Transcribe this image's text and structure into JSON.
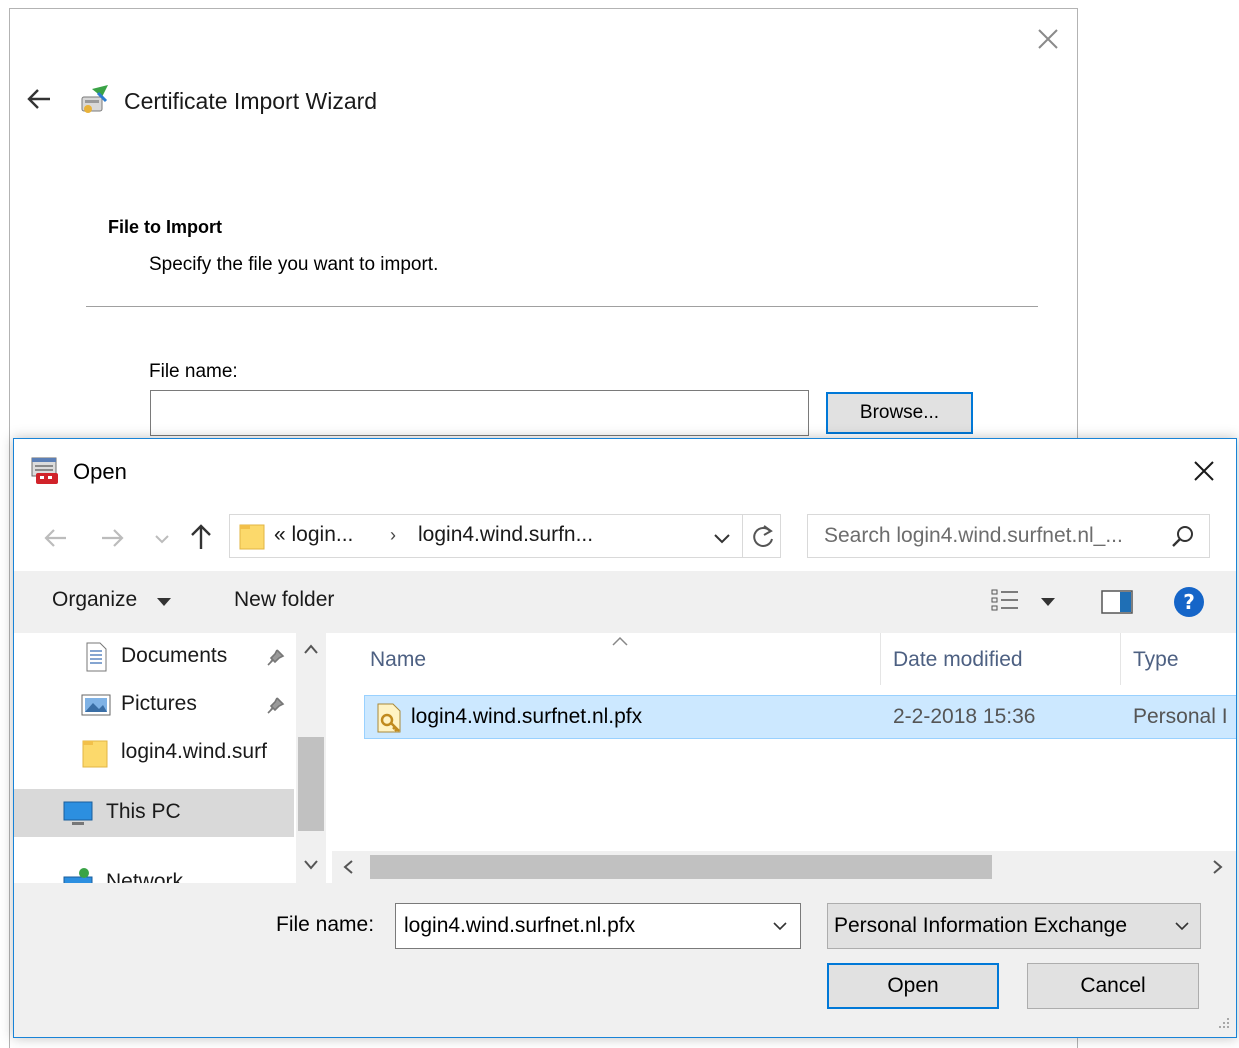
{
  "wizard": {
    "title": "Certificate Import Wizard",
    "section_title": "File to Import",
    "section_desc": "Specify the file you want to import.",
    "file_name_label": "File name:",
    "file_name_value": "",
    "browse_label": "Browse..."
  },
  "open_dialog": {
    "title": "Open",
    "address": {
      "segment_1": "« login...",
      "separator": "›",
      "segment_2": "login4.wind.surfn..."
    },
    "search_placeholder": "Search login4.wind.surfnet.nl_...",
    "toolbar": {
      "organize": "Organize",
      "new_folder": "New folder"
    },
    "nav_items": [
      {
        "label": "Documents",
        "icon": "documents-icon",
        "pinned": true
      },
      {
        "label": "Pictures",
        "icon": "pictures-icon",
        "pinned": true
      },
      {
        "label": "login4.wind.surf",
        "icon": "folder-icon",
        "pinned": false
      },
      {
        "label": "This PC",
        "icon": "this-pc-icon",
        "selected": true
      },
      {
        "label": "Network",
        "icon": "network-icon"
      }
    ],
    "columns": {
      "name": "Name",
      "date_modified": "Date modified",
      "type": "Type"
    },
    "files": [
      {
        "name": "login4.wind.surfnet.nl.pfx",
        "date_modified": "2-2-2018 15:36",
        "type": "Personal I",
        "selected": true
      }
    ],
    "file_name_label": "File name:",
    "file_name_value": "login4.wind.surfnet.nl.pfx",
    "file_type_filter": "Personal Information Exchange",
    "open_label": "Open",
    "cancel_label": "Cancel"
  },
  "colors": {
    "accent": "#0078d7",
    "selection": "#cce8ff",
    "column_header_text": "#4d6082",
    "toolbar_bg": "#f0f0f0"
  }
}
